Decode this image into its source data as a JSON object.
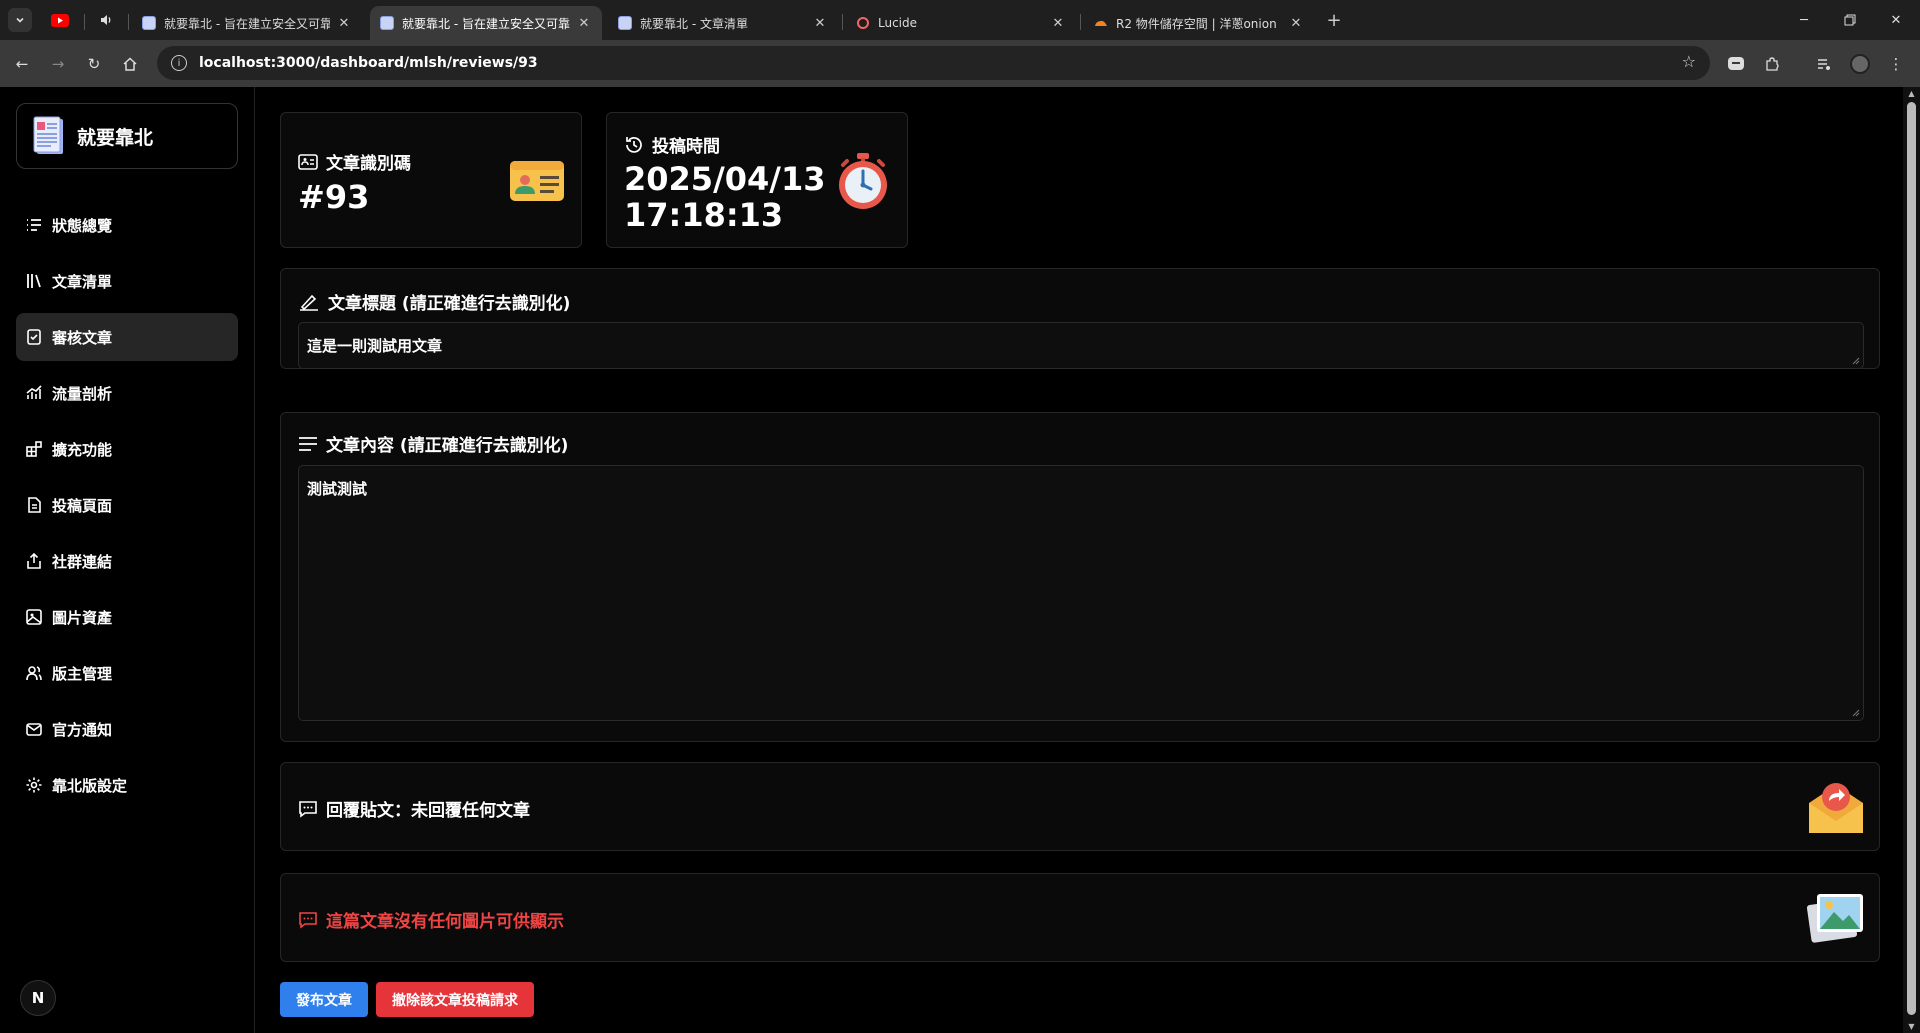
{
  "browser": {
    "tabs": [
      {
        "title": "就要靠北 - 旨在建立安全又可靠",
        "active": false
      },
      {
        "title": "就要靠北 - 旨在建立安全又可靠",
        "active": true
      },
      {
        "title": "就要靠北 - 文章清單",
        "active": false
      },
      {
        "title": "Lucide",
        "active": false
      },
      {
        "title": "R2 物件儲存空間 | 洋蔥onion",
        "active": false
      }
    ],
    "url": "localhost:3000/dashboard/mlsh/reviews/93"
  },
  "sidebar": {
    "brand": "就要靠北",
    "items": [
      {
        "label": "狀態總覽",
        "icon": "list-icon"
      },
      {
        "label": "文章清單",
        "icon": "library-icon"
      },
      {
        "label": "審核文章",
        "icon": "clipboard-check-icon"
      },
      {
        "label": "流量剖析",
        "icon": "chart-icon"
      },
      {
        "label": "擴充功能",
        "icon": "blocks-icon"
      },
      {
        "label": "投稿頁面",
        "icon": "file-text-icon"
      },
      {
        "label": "社群連結",
        "icon": "share-icon"
      },
      {
        "label": "圖片資產",
        "icon": "image-icon"
      },
      {
        "label": "版主管理",
        "icon": "users-icon"
      },
      {
        "label": "官方通知",
        "icon": "mail-icon"
      },
      {
        "label": "靠北版設定",
        "icon": "gear-icon"
      }
    ],
    "active_index": 2,
    "footer_badge": "N"
  },
  "post": {
    "id_label": "文章識別碼",
    "id_value": "#93",
    "time_label": "投稿時間",
    "time_date": "2025/04/13",
    "time_clock": "17:18:13",
    "title_label": "文章標題 (請正確進行去識別化)",
    "title_value": "這是一則測試用文章",
    "content_label": "文章內容 (請正確進行去識別化)",
    "content_value": "測試測試",
    "reply_label": "回覆貼文：未回覆任何文章",
    "images_label": "這篇文章沒有任何圖片可供顯示"
  },
  "actions": {
    "publish": "發布文章",
    "reject": "撤除該文章投稿請求"
  },
  "colors": {
    "publish_button": "#2f7fed",
    "reject_button": "#e5353b",
    "warning_text": "#ef4444"
  }
}
